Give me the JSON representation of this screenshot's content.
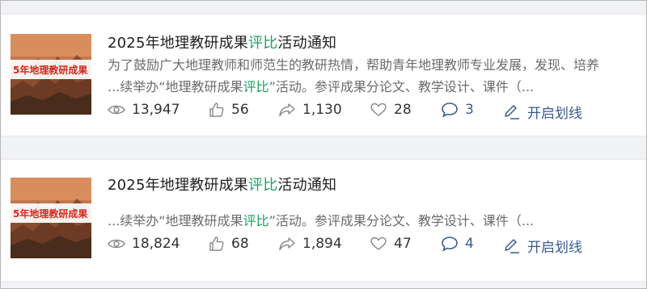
{
  "articles": [
    {
      "thumbnail_text": "5年地理教研成果",
      "title_pre": "2025年地理教研成果",
      "title_hl": "评比",
      "title_post": "活动通知",
      "excerpt_lines": [
        {
          "pre": "为了鼓励广大地理教师和师范生的教研热情，帮助青年地理教师专业发展，发现、培养",
          "hl": "",
          "post": ""
        },
        {
          "pre": "...续举办“地理教研成果",
          "hl": "评比",
          "post": "”活动。参评成果分论文、教学设计、课件（..."
        }
      ],
      "stats": {
        "views": "13,947",
        "likes": "56",
        "shares": "1,130",
        "favorites": "28",
        "comments": "3",
        "highlight_label": "开启划线"
      }
    },
    {
      "thumbnail_text": "5年地理教研成果",
      "title_pre": "2025年地理教研成果",
      "title_hl": "评比",
      "title_post": "活动通知",
      "excerpt_lines": [
        {
          "pre": "...续举办“地理教研成果",
          "hl": "评比",
          "post": "”活动。参评成果分论文、教学设计、课件（..."
        }
      ],
      "stats": {
        "views": "18,824",
        "likes": "68",
        "shares": "1,894",
        "favorites": "47",
        "comments": "4",
        "highlight_label": "开启划线"
      }
    }
  ],
  "colors": {
    "highlight": "#19a15f",
    "link": "#3b5b8f",
    "title": "#1f1f1f",
    "excerpt": "#6b6b6b"
  },
  "icons": [
    "eye-icon",
    "thumbs-up-icon",
    "share-arrow-icon",
    "heart-icon",
    "comment-bubble-icon",
    "pen-underline-icon"
  ]
}
